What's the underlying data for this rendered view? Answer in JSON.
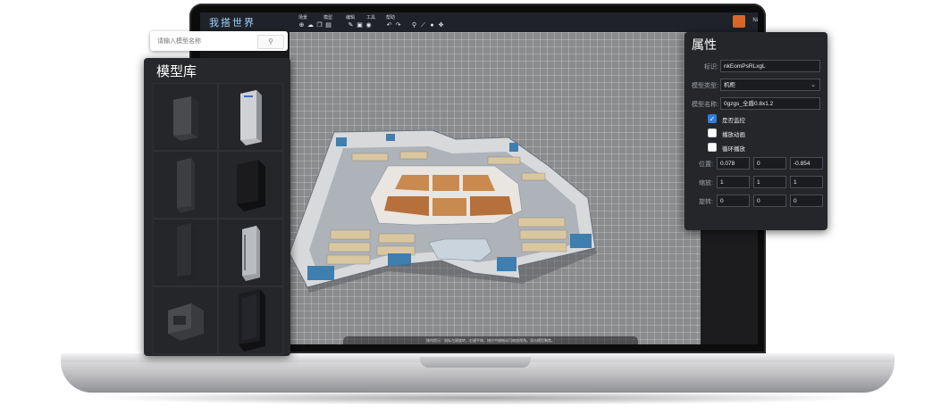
{
  "app": {
    "brand": "我搭世界",
    "user_abbr": "Ni"
  },
  "toolbar": {
    "groups": [
      {
        "label": "场景",
        "icons": [
          "add-icon",
          "upload-icon",
          "copy-icon",
          "paste-icon"
        ]
      },
      {
        "label": "模型",
        "icons": [
          "edit-icon",
          "image-icon",
          "camera-icon"
        ]
      },
      {
        "label": "编辑",
        "icons": [
          "undo-icon",
          "redo-icon"
        ]
      },
      {
        "label": "工具",
        "icons": [
          "wrench-icon",
          "ruler-icon",
          "navigate-icon",
          "settings-icon"
        ]
      },
      {
        "label": "帮助",
        "icons": []
      }
    ]
  },
  "search": {
    "placeholder": "请输入模型名称"
  },
  "library": {
    "title": "模型库",
    "items": [
      "cabinet-dark",
      "cabinet-server",
      "cabinet-slim",
      "cabinet-black",
      "cabinet-tall",
      "cabinet-gray",
      "cabinet-box",
      "cabinet-glass"
    ]
  },
  "properties": {
    "title": "属性",
    "id_label": "标识:",
    "id_value": "nkEomPsRLxgL",
    "type_label": "模型类型:",
    "type_value": "机柜",
    "name_label": "模型名称:",
    "name_value": "0gzgs_全盾0.8x1.2",
    "checkboxes": [
      {
        "label": "是否监控",
        "checked": true
      },
      {
        "label": "播放动画",
        "checked": false
      },
      {
        "label": "循环播放",
        "checked": false
      }
    ],
    "position_label": "位置:",
    "position": [
      "0.078",
      "0",
      "-0.854"
    ],
    "scale_label": "缩放:",
    "scale": [
      "1",
      "1",
      "1"
    ],
    "rotation_label": "旋转:",
    "rotation": [
      "0",
      "0",
      "0"
    ]
  },
  "viewport": {
    "hint": "操作提示：鼠标左键旋转，右键平移，按住中键拖动可缩放视角。双击模型聚焦。"
  },
  "colors": {
    "accent": "#2f7de1",
    "panel": "#242629",
    "brand": "#9fd3ff"
  }
}
